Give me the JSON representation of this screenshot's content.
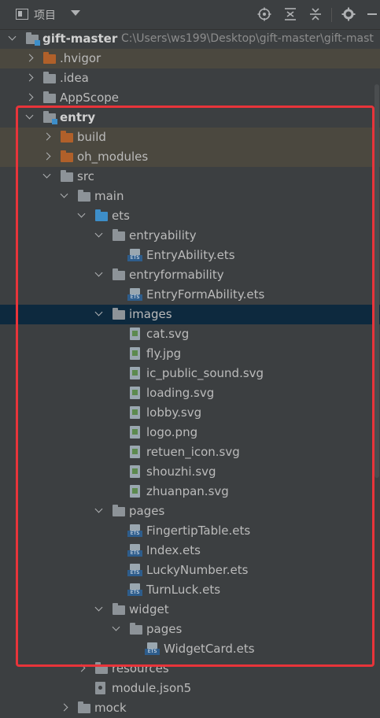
{
  "toolbar": {
    "title": "项目",
    "icons": [
      "project-icon",
      "dropdown-caret-icon",
      "locate-icon",
      "expand-all-icon",
      "collapse-all-icon",
      "settings-icon",
      "hide-icon"
    ]
  },
  "tree": [
    {
      "label": "gift-master",
      "path": "C:\\Users\\ws199\\Desktop\\gift-master\\gift-mast",
      "type": "module",
      "bold": true,
      "expanded": true
    },
    {
      "label": ".hvigor",
      "type": "folder-orange",
      "expanded": false,
      "excluded": true
    },
    {
      "label": ".idea",
      "type": "folder-gray",
      "expanded": false
    },
    {
      "label": "AppScope",
      "type": "folder-gray",
      "expanded": false
    },
    {
      "label": "entry",
      "type": "module",
      "bold": true,
      "expanded": true
    },
    {
      "label": "build",
      "type": "folder-orange",
      "expanded": false,
      "excluded": true
    },
    {
      "label": "oh_modules",
      "type": "folder-orange",
      "expanded": false,
      "excluded": true
    },
    {
      "label": "src",
      "type": "folder-gray",
      "expanded": true
    },
    {
      "label": "main",
      "type": "folder-gray",
      "expanded": true
    },
    {
      "label": "ets",
      "type": "folder-blue",
      "expanded": true
    },
    {
      "label": "entryability",
      "type": "folder-gray",
      "expanded": true
    },
    {
      "label": "EntryAbility.ets",
      "type": "file-ets"
    },
    {
      "label": "entryformability",
      "type": "folder-gray",
      "expanded": true
    },
    {
      "label": "EntryFormAbility.ets",
      "type": "file-ets"
    },
    {
      "label": "images",
      "type": "folder-gray",
      "expanded": true,
      "selected": true
    },
    {
      "label": "cat.svg",
      "type": "file-image"
    },
    {
      "label": "fly.jpg",
      "type": "file-image"
    },
    {
      "label": "ic_public_sound.svg",
      "type": "file-image"
    },
    {
      "label": "loading.svg",
      "type": "file-image"
    },
    {
      "label": "lobby.svg",
      "type": "file-image"
    },
    {
      "label": "logo.png",
      "type": "file-image"
    },
    {
      "label": "retuen_icon.svg",
      "type": "file-image"
    },
    {
      "label": "shouzhi.svg",
      "type": "file-image"
    },
    {
      "label": "zhuanpan.svg",
      "type": "file-image"
    },
    {
      "label": "pages",
      "type": "folder-gray",
      "expanded": true
    },
    {
      "label": "FingertipTable.ets",
      "type": "file-ets"
    },
    {
      "label": "Index.ets",
      "type": "file-ets"
    },
    {
      "label": "LuckyNumber.ets",
      "type": "file-ets"
    },
    {
      "label": "TurnLuck.ets",
      "type": "file-ets"
    },
    {
      "label": "widget",
      "type": "folder-gray",
      "expanded": true
    },
    {
      "label": "pages",
      "type": "folder-gray",
      "expanded": true
    },
    {
      "label": "WidgetCard.ets",
      "type": "file-ets"
    },
    {
      "label": "resources",
      "type": "folder-gray",
      "expanded": false
    },
    {
      "label": "module.json5",
      "type": "file-json"
    },
    {
      "label": "mock",
      "type": "folder-gray",
      "expanded": false
    }
  ],
  "colors": {
    "highlight_border": "#e8343a",
    "selected_row": "#0d293e",
    "background": "#3c3f41"
  }
}
